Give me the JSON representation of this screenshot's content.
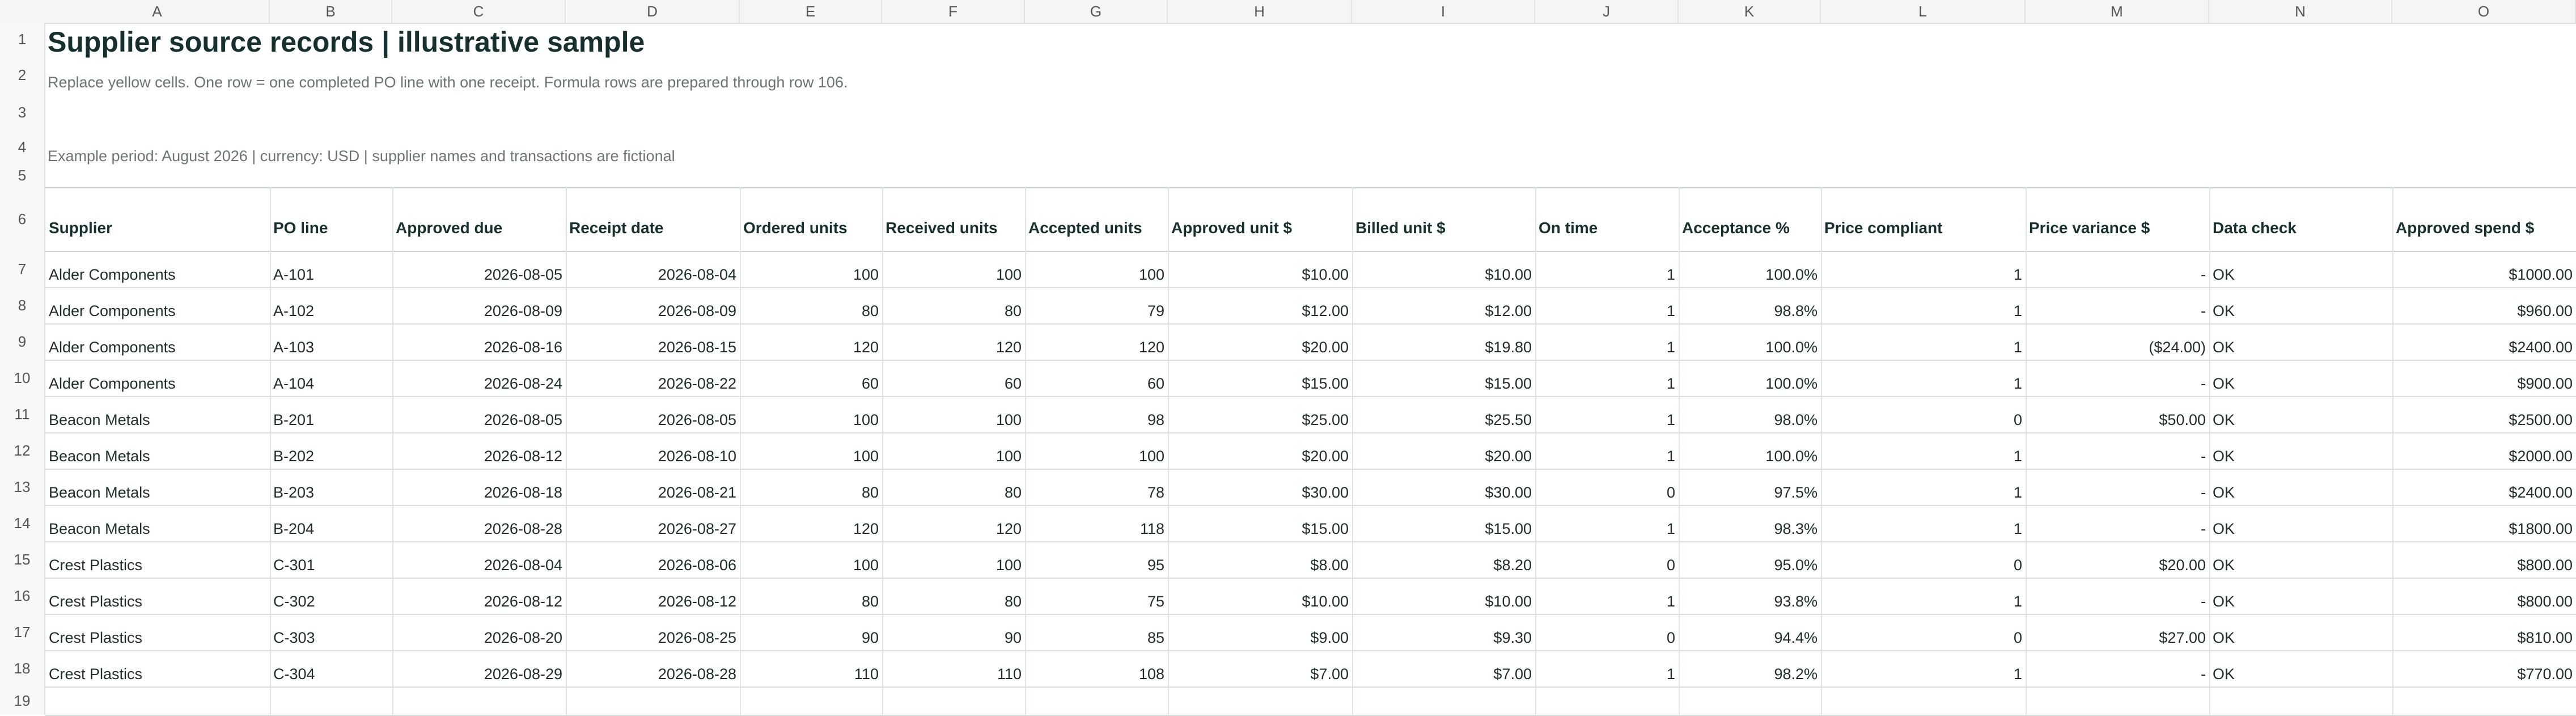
{
  "sheet": {
    "columns": [
      "A",
      "B",
      "C",
      "D",
      "E",
      "F",
      "G",
      "H",
      "I",
      "J",
      "K",
      "L",
      "M",
      "N",
      "O"
    ],
    "rows": [
      "1",
      "2",
      "3",
      "4",
      "5",
      "6",
      "7",
      "8",
      "9",
      "10",
      "11",
      "12",
      "13",
      "14",
      "15",
      "16",
      "17",
      "18",
      "19"
    ],
    "title": "Supplier source records | illustrative sample",
    "note1": "Replace yellow cells. One row = one completed PO line with one receipt. Formula rows are prepared through row 106.",
    "note2": "Example period: August 2026 | currency: USD | supplier names and transactions are fictional",
    "headers": [
      "Supplier",
      "PO line",
      "Approved due",
      "Receipt date",
      "Ordered units",
      "Received units",
      "Accepted units",
      "Approved unit $",
      "Billed unit $",
      "On time",
      "Acceptance %",
      "Price compliant",
      "Price variance $",
      "Data check",
      "Approved spend $"
    ],
    "records": [
      [
        "Alder Components",
        "A-101",
        "2026-08-05",
        "2026-08-04",
        "100",
        "100",
        "100",
        "$10.00",
        "$10.00",
        "1",
        "100.0%",
        "1",
        "-",
        "OK",
        "$1000.00"
      ],
      [
        "Alder Components",
        "A-102",
        "2026-08-09",
        "2026-08-09",
        "80",
        "80",
        "79",
        "$12.00",
        "$12.00",
        "1",
        "98.8%",
        "1",
        "-",
        "OK",
        "$960.00"
      ],
      [
        "Alder Components",
        "A-103",
        "2026-08-16",
        "2026-08-15",
        "120",
        "120",
        "120",
        "$20.00",
        "$19.80",
        "1",
        "100.0%",
        "1",
        "($24.00)",
        "OK",
        "$2400.00"
      ],
      [
        "Alder Components",
        "A-104",
        "2026-08-24",
        "2026-08-22",
        "60",
        "60",
        "60",
        "$15.00",
        "$15.00",
        "1",
        "100.0%",
        "1",
        "-",
        "OK",
        "$900.00"
      ],
      [
        "Beacon Metals",
        "B-201",
        "2026-08-05",
        "2026-08-05",
        "100",
        "100",
        "98",
        "$25.00",
        "$25.50",
        "1",
        "98.0%",
        "0",
        "$50.00",
        "OK",
        "$2500.00"
      ],
      [
        "Beacon Metals",
        "B-202",
        "2026-08-12",
        "2026-08-10",
        "100",
        "100",
        "100",
        "$20.00",
        "$20.00",
        "1",
        "100.0%",
        "1",
        "-",
        "OK",
        "$2000.00"
      ],
      [
        "Beacon Metals",
        "B-203",
        "2026-08-18",
        "2026-08-21",
        "80",
        "80",
        "78",
        "$30.00",
        "$30.00",
        "0",
        "97.5%",
        "1",
        "-",
        "OK",
        "$2400.00"
      ],
      [
        "Beacon Metals",
        "B-204",
        "2026-08-28",
        "2026-08-27",
        "120",
        "120",
        "118",
        "$15.00",
        "$15.00",
        "1",
        "98.3%",
        "1",
        "-",
        "OK",
        "$1800.00"
      ],
      [
        "Crest Plastics",
        "C-301",
        "2026-08-04",
        "2026-08-06",
        "100",
        "100",
        "95",
        "$8.00",
        "$8.20",
        "0",
        "95.0%",
        "0",
        "$20.00",
        "OK",
        "$800.00"
      ],
      [
        "Crest Plastics",
        "C-302",
        "2026-08-12",
        "2026-08-12",
        "80",
        "80",
        "75",
        "$10.00",
        "$10.00",
        "1",
        "93.8%",
        "1",
        "-",
        "OK",
        "$800.00"
      ],
      [
        "Crest Plastics",
        "C-303",
        "2026-08-20",
        "2026-08-25",
        "90",
        "90",
        "85",
        "$9.00",
        "$9.30",
        "0",
        "94.4%",
        "0",
        "$27.00",
        "OK",
        "$810.00"
      ],
      [
        "Crest Plastics",
        "C-304",
        "2026-08-29",
        "2026-08-28",
        "110",
        "110",
        "108",
        "$7.00",
        "$7.00",
        "1",
        "98.2%",
        "1",
        "-",
        "OK",
        "$770.00"
      ]
    ]
  }
}
